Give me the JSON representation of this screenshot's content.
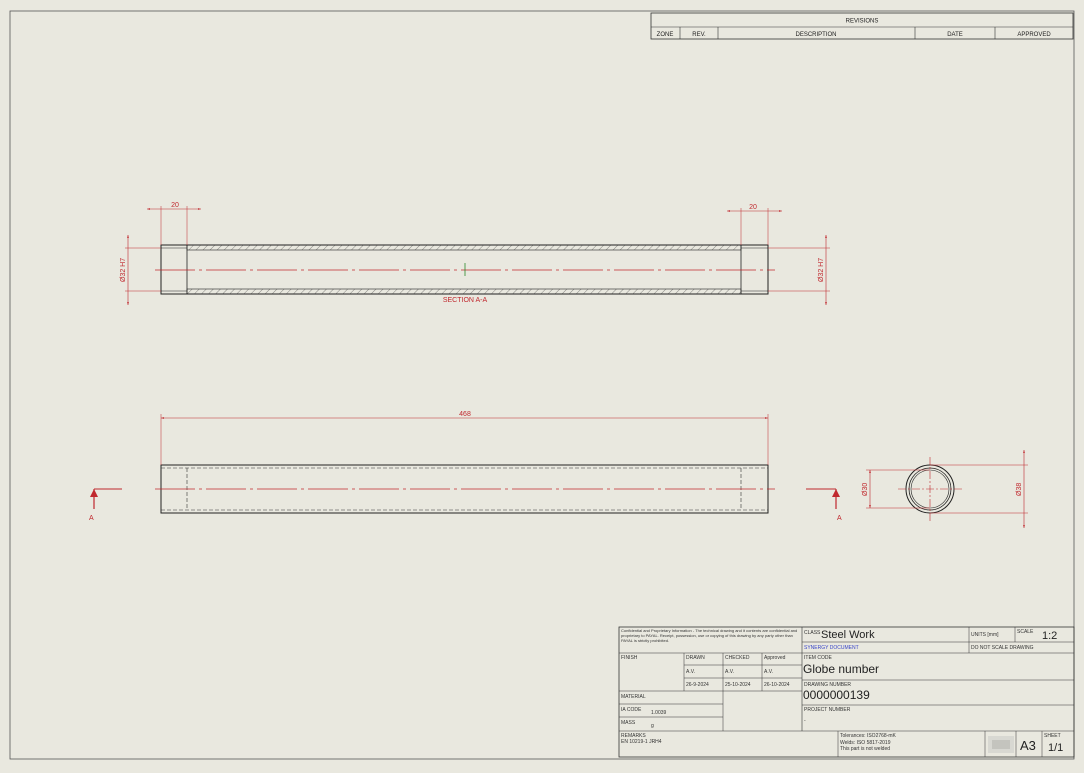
{
  "revisions": {
    "title": "REVISIONS",
    "columns": [
      "ZONE",
      "REV.",
      "DESCRIPTION",
      "DATE",
      "APPROVED"
    ]
  },
  "views": {
    "section": {
      "label": "SECTION A-A",
      "dim_left": "20",
      "dim_right": "20",
      "bore_left": "Ø32 H7",
      "bore_right": "Ø32 H7"
    },
    "front": {
      "length": "468",
      "marker_left": "A",
      "marker_right": "A"
    },
    "end": {
      "inner_dia": "Ø30",
      "outer_dia": "Ø38"
    }
  },
  "title_block": {
    "confidential": "Confidential and Proprietary Information - The technical drawing and it contents are confidential and proprietary to PAYAL. Receipt, possession, use or copying of this drawing by any party other than PAYAL is strictly prohibited.",
    "class_label": "CLASS",
    "class_value": "Steel Work",
    "units": "UNITS [mm]",
    "scale_label": "SCALE",
    "scale_value": "1:2",
    "synergy": "SYNERGY DOCUMENT",
    "no_scale": "DO NOT SCALE DRAWING",
    "finish_label": "FINISH",
    "drawn_label": "DRAWN",
    "checked_label": "CHECKED",
    "approved_label": "Approved",
    "drawn_by": "A.V.",
    "checked_by": "A.V.",
    "approved_by": "A.V.",
    "drawn_date": "26-9-2024",
    "checked_date": "25-10-2024",
    "approved_date": "26-10-2024",
    "item_code_label": "ITEM CODE",
    "item_code_value": "Globe number",
    "drawing_number_label": "DRAWING NUMBER",
    "drawing_number_value": "0000000139",
    "project_number_label": "PROJECT NUMBER",
    "project_number_value": "-",
    "material_label": "MATERIAL",
    "ia_code_label": "IA CODE",
    "ia_code_value": "1.0039",
    "mass_label": "MASS",
    "mass_value": "g",
    "remarks_label": "REMARKS",
    "remarks_value": "EN 10219-1 JRH4",
    "tolerances": "Tolerances: ISO2768-mK",
    "welds": "Welds: ISO 5817-2019",
    "weld_note": "This part is not welded",
    "sheet_size": "A3",
    "sheet_label": "SHEET",
    "sheet_value": "1/1"
  }
}
